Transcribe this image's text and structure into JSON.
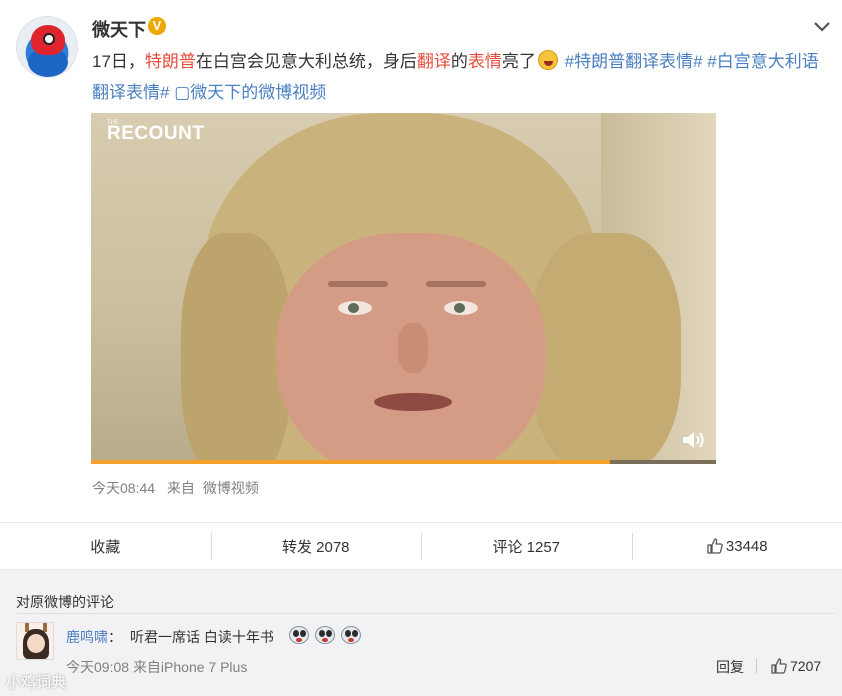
{
  "post": {
    "username": "微天下",
    "verified_mark": "V",
    "text_segments": [
      {
        "text": "17日，",
        "style": "normal"
      },
      {
        "text": "特朗普",
        "style": "red"
      },
      {
        "text": "在白宫会见意大利总统，身后",
        "style": "normal"
      },
      {
        "text": "翻译",
        "style": "red"
      },
      {
        "text": "的",
        "style": "normal"
      },
      {
        "text": "表情",
        "style": "red"
      },
      {
        "text": "亮了",
        "style": "normal"
      },
      {
        "text": "",
        "style": "emoji"
      },
      {
        "text": " #特朗普翻译表情#",
        "style": "blue"
      },
      {
        "text": " #白宫意大利语翻译表情#",
        "style": "blue"
      },
      {
        "text": " ▢微天下的微博视频",
        "style": "blue"
      }
    ],
    "video": {
      "watermark_small": "THE",
      "watermark": "RECOUNT",
      "progress": 0.83,
      "progress_color": "#f3a02a"
    },
    "meta": {
      "time": "今天08:44",
      "source_prefix": "来自",
      "source": "微博视频"
    }
  },
  "actions": {
    "favorite": "收藏",
    "repost": "转发 2078",
    "comment": "评论 1257",
    "like": "33448"
  },
  "comments": {
    "title": "对原微博的评论",
    "items": [
      {
        "name": "鹿鸣啸",
        "separator": "：",
        "text": "听君一席话 白读十年书",
        "time": "今天09:08",
        "source": "来自iPhone 7 Plus",
        "reply_label": "回复",
        "likes": "7207"
      }
    ]
  },
  "watermark_text": "小鸡词典",
  "icons": {
    "verified": "verified-badge-icon",
    "menu": "chevron-down-icon",
    "volume": "volume-icon",
    "like": "thumbs-up-icon",
    "emoji": "laughing-emoji-icon",
    "comment_emoji": "doge-emoji-icon"
  },
  "colors": {
    "highlight_red": "#e74c3c",
    "link_blue": "#4a7fc1",
    "verified_gold": "#f0a800"
  }
}
